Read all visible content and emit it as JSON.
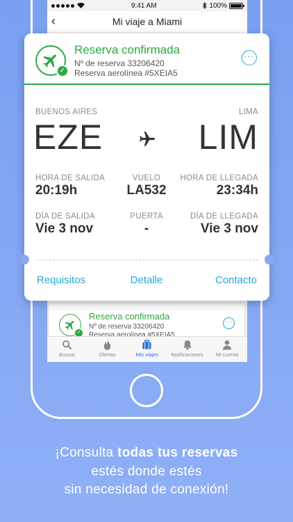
{
  "status_bar": {
    "time": "9:41 AM",
    "battery": "100%"
  },
  "nav": {
    "title": "Mi viaje a Miami"
  },
  "booking": {
    "status": "Reserva confirmada",
    "reservation_number": "Nº de reserva 33206420",
    "airline_reservation": "Reserva aerolínea #5XEIA5",
    "origin_city": "BUENOS AIRES",
    "origin_code": "EZE",
    "destination_city": "LIMA",
    "destination_code": "LIM",
    "departure_time_label": "HORA DE SALIDA",
    "departure_time": "20:19h",
    "flight_label": "VUELO",
    "flight": "LA532",
    "arrival_time_label": "HORA DE LLEGADA",
    "arrival_time": "23:34h",
    "departure_day_label": "DÍA DE SALIDA",
    "departure_day": "Vie 3 nov",
    "gate_label": "PUERTA",
    "gate": "-",
    "arrival_day_label": "DÍA DE LLEGADA",
    "arrival_day": "Vie 3 nov"
  },
  "actions": {
    "requirements": "Requisitos",
    "detail": "Detalle",
    "contact": "Contacto"
  },
  "mini_booking": {
    "status": "Reserva confirmada",
    "reservation_number": "Nº de reserva 33206420",
    "airline_reservation": "Reserva aerolínea #5XEIA5"
  },
  "tabs": [
    {
      "label": "Buscar",
      "icon": "search-icon"
    },
    {
      "label": "Ofertas",
      "icon": "flame-icon"
    },
    {
      "label": "Mis viajes",
      "icon": "suitcase-icon",
      "active": true
    },
    {
      "label": "Notificaciones",
      "icon": "bell-icon"
    },
    {
      "label": "Mi cuenta",
      "icon": "user-icon"
    }
  ],
  "caption": {
    "line1_prefix": "¡Consulta ",
    "line1_bold": "todas tus reservas",
    "line2": "estés donde estés",
    "line3": "sin necesidad de conexión!"
  },
  "colors": {
    "accent_green": "#2ca843",
    "accent_blue": "#2aa6d6",
    "tab_active": "#2a72d6",
    "background": "#7aa0f2"
  }
}
